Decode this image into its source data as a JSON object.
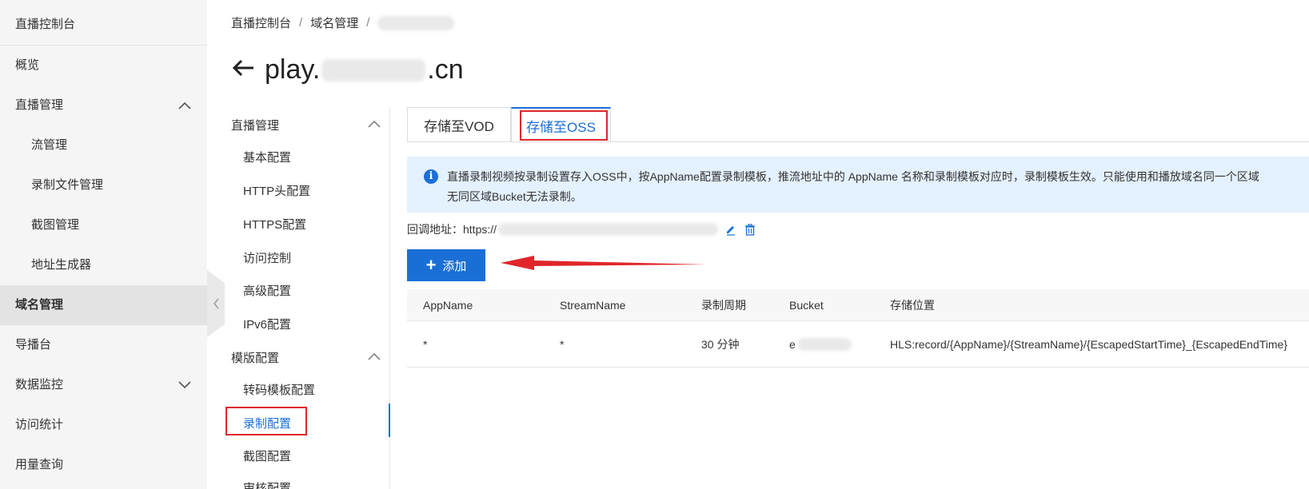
{
  "sidebar": {
    "title": "直播控制台",
    "items": [
      {
        "label": "概览"
      },
      {
        "label": "直播管理"
      },
      {
        "label": "流管理"
      },
      {
        "label": "录制文件管理"
      },
      {
        "label": "截图管理"
      },
      {
        "label": "地址生成器"
      },
      {
        "label": "域名管理"
      },
      {
        "label": "导播台"
      },
      {
        "label": "数据监控"
      },
      {
        "label": "访问统计"
      },
      {
        "label": "用量查询"
      }
    ]
  },
  "breadcrumb": {
    "items": [
      "直播控制台",
      "域名管理"
    ],
    "separator": "/"
  },
  "page_title": {
    "prefix": "play.",
    "suffix": ".cn"
  },
  "subnav": {
    "group1": "直播管理",
    "group1_items": [
      "基本配置",
      "HTTP头配置",
      "HTTPS配置",
      "访问控制",
      "高级配置",
      "IPv6配置"
    ],
    "group2": "模版配置",
    "group2_items": [
      "转码模板配置",
      "录制配置",
      "截图配置",
      "审核配置"
    ]
  },
  "tabs": [
    {
      "label": "存储至VOD"
    },
    {
      "label": "存储至OSS"
    }
  ],
  "info": {
    "icon": "info-circle-icon",
    "line1": "直播录制视频按录制设置存入OSS中，按AppName配置录制模板，推流地址中的 AppName 名称和录制模板对应时，录制模板生效。只能使用和播放域名同一个区域",
    "line2": "无同区域Bucket无法录制。"
  },
  "callback": {
    "label": "回调地址：",
    "value_prefix": "https://"
  },
  "add_button": {
    "label": "添加"
  },
  "table": {
    "columns": [
      "AppName",
      "StreamName",
      "录制周期",
      "Bucket",
      "存储位置"
    ],
    "rows": [
      {
        "app": "*",
        "stream": "*",
        "period": "30 分钟",
        "bucket_prefix": "e",
        "location": "HLS:record/{AppName}/{StreamName}/{EscapedStartTime}_{EscapedEndTime}"
      }
    ]
  },
  "colors": {
    "accent": "#1a6fd6",
    "highlight": "#e0262a",
    "info_bg": "#e4f1fe",
    "sidebar_bg": "#f5f5f5"
  }
}
